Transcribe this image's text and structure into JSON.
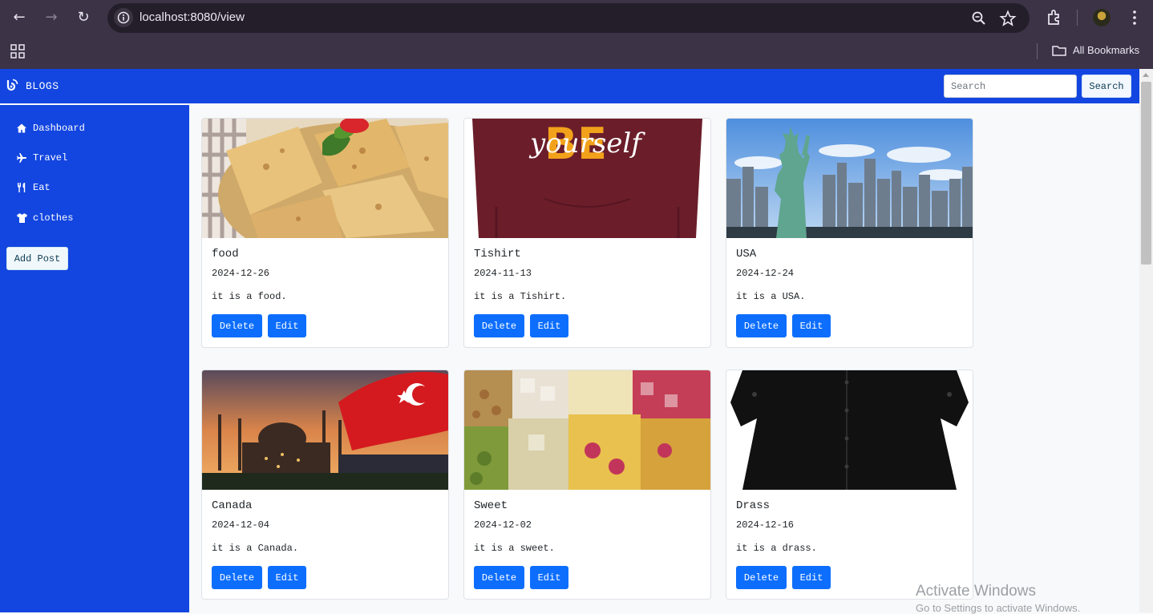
{
  "browser": {
    "url": "localhost:8080/view",
    "bookmarks_label": "All Bookmarks"
  },
  "header": {
    "brand": "BLOGS",
    "search_placeholder": "Search",
    "search_button": "Search"
  },
  "sidebar": {
    "items": [
      {
        "label": "Dashboard",
        "icon": "home-icon"
      },
      {
        "label": "Travel",
        "icon": "plane-icon"
      },
      {
        "label": "Eat",
        "icon": "utensils-icon"
      },
      {
        "label": "clothes",
        "icon": "shirt-icon"
      }
    ],
    "add_post": "Add Post"
  },
  "cards": [
    {
      "title": "food",
      "date": "2024-12-26",
      "text": "it is a food.",
      "delete": "Delete",
      "edit": "Edit",
      "image": "flatbread-photo"
    },
    {
      "title": "Tishirt",
      "date": "2024-11-13",
      "text": "it is a Tishirt.",
      "delete": "Delete",
      "edit": "Edit",
      "image": "hoodie-photo",
      "image_text": "yourself"
    },
    {
      "title": "USA",
      "date": "2024-12-24",
      "text": "it is a USA.",
      "delete": "Delete",
      "edit": "Edit",
      "image": "statue-of-liberty-photo"
    },
    {
      "title": "Canada",
      "date": "2024-12-04",
      "text": "it is a Canada.",
      "delete": "Delete",
      "edit": "Edit",
      "image": "mosque-flag-photo"
    },
    {
      "title": "Sweet",
      "date": "2024-12-02",
      "text": "it is a sweet.",
      "delete": "Delete",
      "edit": "Edit",
      "image": "turkish-delight-photo"
    },
    {
      "title": "Drass",
      "date": "2024-12-16",
      "text": "it is a drass.",
      "delete": "Delete",
      "edit": "Edit",
      "image": "black-blouse-photo"
    }
  ],
  "watermark": {
    "line1": "Activate Windows",
    "line2": "Go to Settings to activate Windows."
  },
  "colors": {
    "brand_blue": "#1346e0",
    "button_blue": "#0d6efd",
    "chrome_bg": "#3c3347"
  }
}
